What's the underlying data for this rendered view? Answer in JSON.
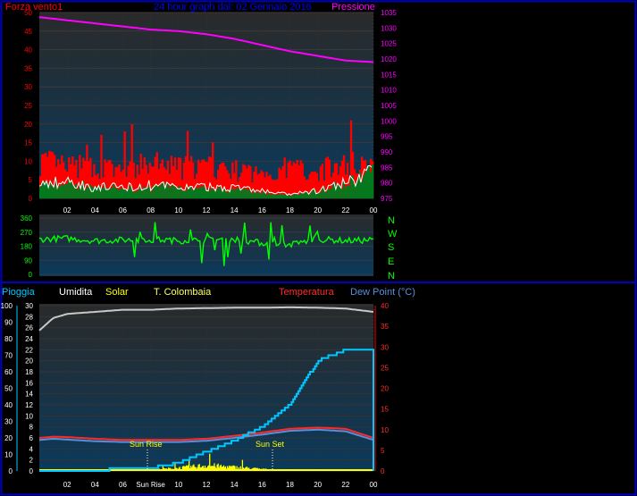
{
  "colors": {
    "background": "#000000",
    "frame": "#0000c0",
    "wind_red": "#ff0000",
    "wind_green": "#007a1e",
    "pressure": "#ff00ff",
    "direction": "#00ff00",
    "rain": "#00c8ff",
    "humidity": "#c8c8c8",
    "solar": "#ffff00",
    "temperature": "#ff2a2a",
    "dew_point": "#5a8fd8",
    "app_temp": "#ffffff"
  },
  "top": {
    "left_title": "Forza vento1",
    "center_title": "24 hour graph dal:  02 Gennaio 2016",
    "right_title": "Pressione"
  },
  "middle": {
    "compass_labels": [
      "N",
      "W",
      "S",
      "E",
      "N"
    ]
  },
  "bottom": {
    "legend": {
      "rain": "Pioggia",
      "humidity": "Umidita",
      "solar": "Solar",
      "app_temp": "T. Colombaia",
      "temperature": "Temperatura",
      "dew_point": "Dew Point (°C)"
    },
    "sun_rise_label": "Sun Rise",
    "sun_set_label": "Sun Set",
    "sun_rise_tick": "Sun Rise"
  },
  "chart_data": [
    {
      "type": "line",
      "name": "wind-pressure",
      "x_ticks": [
        "02",
        "04",
        "06",
        "08",
        "10",
        "12",
        "14",
        "16",
        "18",
        "20",
        "22",
        "00"
      ],
      "y_left_ticks": [
        "0",
        "5",
        "10",
        "15",
        "20",
        "25",
        "30",
        "35",
        "40",
        "45",
        "50"
      ],
      "y_right_ticks": [
        "975",
        "980",
        "985",
        "990",
        "995",
        "1000",
        "1005",
        "1010",
        "1015",
        "1020",
        "1025",
        "1030",
        "1035"
      ],
      "ylim_left": [
        0,
        50
      ],
      "ylim_right": [
        975,
        1035
      ],
      "x_hours": [
        0,
        2,
        4,
        6,
        8,
        10,
        12,
        14,
        16,
        18,
        20,
        22,
        24
      ],
      "series": [
        {
          "name": "Forza vento1",
          "axis": "left",
          "values": [
            11,
            9,
            9,
            8,
            10,
            9,
            9,
            8,
            7,
            9,
            8,
            10,
            11
          ]
        },
        {
          "axis": "left",
          "values": [
            4,
            4.5,
            3,
            3,
            3.5,
            3,
            3,
            3,
            2,
            1,
            2,
            4,
            7
          ]
        },
        {
          "axis": "left",
          "values": [
            2,
            2,
            1.5,
            1,
            1.5,
            1.5,
            1,
            1,
            0.5,
            0.3,
            1,
            2,
            4
          ]
        },
        {
          "name": "Pressione",
          "axis": "right",
          "values": [
            1033.5,
            1032.5,
            1031.5,
            1030.5,
            1029.5,
            1029,
            1028,
            1026.5,
            1024.5,
            1022.5,
            1021,
            1019.5,
            1019
          ]
        }
      ]
    },
    {
      "type": "line",
      "name": "wind-direction",
      "y_ticks": [
        "0",
        "90",
        "180",
        "270",
        "360"
      ],
      "ylim": [
        0,
        360
      ],
      "x_hours": [
        0,
        2,
        4,
        6,
        8,
        10,
        12,
        14,
        16,
        18,
        20,
        22,
        24
      ],
      "values": [
        225,
        230,
        215,
        220,
        225,
        215,
        220,
        225,
        200,
        190,
        225,
        215,
        220
      ]
    },
    {
      "type": "line",
      "name": "temperature-humidity-rain-solar",
      "y_pioggia_ticks": [
        "0",
        "10",
        "20",
        "30",
        "40",
        "50",
        "60",
        "70",
        "80",
        "90",
        "100"
      ],
      "y_umidita_ticks": [
        "0",
        "2",
        "4",
        "6",
        "8",
        "10",
        "12",
        "14",
        "16",
        "18",
        "20",
        "22",
        "24",
        "26",
        "28",
        "30"
      ],
      "y_temp_ticks": [
        "0",
        "5",
        "10",
        "15",
        "20",
        "25",
        "30",
        "35",
        "40"
      ],
      "ylim_left": [
        0,
        30
      ],
      "ylim_right": [
        0,
        40
      ],
      "x_ticks": [
        "02",
        "04",
        "06",
        "Sun Rise",
        "10",
        "12",
        "14",
        "16",
        "18",
        "20",
        "22",
        "00"
      ],
      "x_hours": [
        0,
        1,
        2,
        4,
        6,
        8,
        10,
        12,
        14,
        16,
        18,
        20,
        22,
        24
      ],
      "series": [
        {
          "name": "Umidita",
          "axis": "right",
          "values": [
            34,
            37,
            38,
            38.5,
            39,
            39,
            39.3,
            39.4,
            39.5,
            39.5,
            39.6,
            39.5,
            39.3,
            38.5
          ]
        },
        {
          "name": "Pioggia",
          "axis": "left",
          "values": [
            0,
            0,
            0.1,
            0.2,
            0.3,
            0.5,
            1.5,
            3.5,
            5.5,
            8,
            12,
            20,
            22,
            22
          ]
        },
        {
          "name": "Temperatura",
          "axis": "right",
          "values": [
            8,
            8.3,
            8.2,
            7.8,
            7.5,
            7.5,
            7.5,
            7.8,
            8.5,
            9.3,
            10.2,
            10.5,
            10.2,
            8
          ]
        },
        {
          "name": "Dew Point (°C)",
          "axis": "right",
          "values": [
            7.5,
            7.8,
            7.6,
            7.2,
            7,
            7,
            7,
            7.3,
            8,
            8.8,
            9.7,
            10,
            9.6,
            7.5
          ]
        },
        {
          "name": "Solar",
          "axis": "right",
          "values": [
            0,
            0,
            0,
            0,
            0,
            0.3,
            0.8,
            1.5,
            1,
            0.5,
            0,
            0,
            0,
            0
          ]
        }
      ]
    }
  ]
}
